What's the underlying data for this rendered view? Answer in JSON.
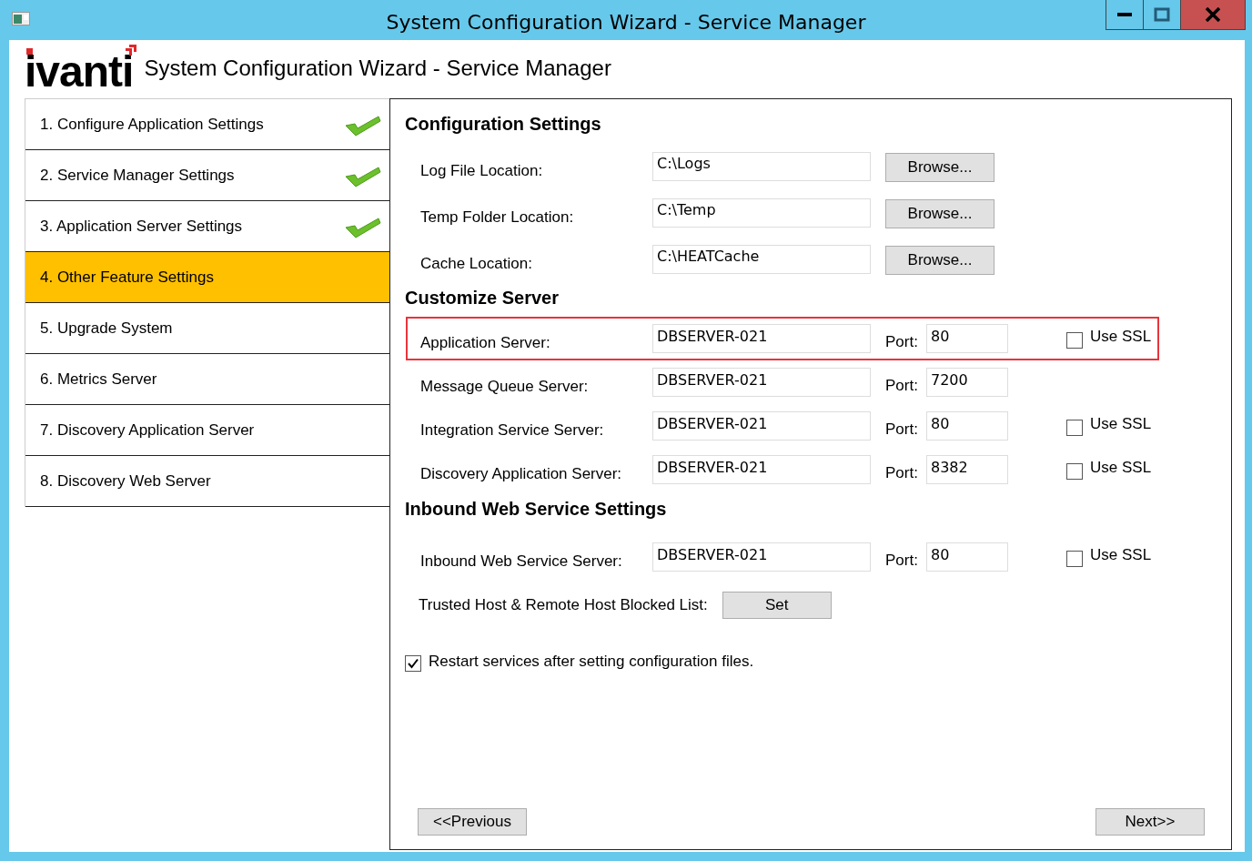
{
  "window": {
    "title": "System Configuration Wizard - Service Manager"
  },
  "header": {
    "logo": "ivanti",
    "title": "System Configuration Wizard - Service Manager"
  },
  "steps": [
    {
      "label": "1. Configure Application Settings",
      "completed": true,
      "selected": false
    },
    {
      "label": "2. Service Manager Settings",
      "completed": true,
      "selected": false
    },
    {
      "label": "3. Application Server Settings",
      "completed": true,
      "selected": false
    },
    {
      "label": "4. Other Feature Settings",
      "completed": false,
      "selected": true
    },
    {
      "label": "5. Upgrade System",
      "completed": false,
      "selected": false
    },
    {
      "label": "6. Metrics Server",
      "completed": false,
      "selected": false
    },
    {
      "label": "7. Discovery Application Server",
      "completed": false,
      "selected": false
    },
    {
      "label": "8. Discovery Web Server",
      "completed": false,
      "selected": false
    }
  ],
  "configuration": {
    "heading": "Configuration Settings",
    "rows": [
      {
        "label": "Log File Location:",
        "value": "C:\\Logs",
        "button": "Browse..."
      },
      {
        "label": "Temp Folder Location:",
        "value": "C:\\Temp",
        "button": "Browse..."
      },
      {
        "label": "Cache Location:",
        "value": "C:\\HEATCache",
        "button": "Browse..."
      }
    ]
  },
  "customize": {
    "heading": "Customize Server",
    "rows": [
      {
        "label": "Application Server:",
        "value": "DBSERVER-021",
        "port_label": "Port:",
        "port": "80",
        "ssl": {
          "label": "Use SSL",
          "checked": false
        },
        "highlighted": true
      },
      {
        "label": "Message Queue Server:",
        "value": "DBSERVER-021",
        "port_label": "Port:",
        "port": "7200",
        "highlighted": false
      },
      {
        "label": "Integration Service Server:",
        "value": "DBSERVER-021",
        "port_label": "Port:",
        "port": "80",
        "ssl": {
          "label": "Use SSL",
          "checked": false
        },
        "highlighted": false
      },
      {
        "label": "Discovery Application Server:",
        "value": "DBSERVER-021",
        "port_label": "Port:",
        "port": "8382",
        "ssl": {
          "label": "Use SSL",
          "checked": false
        },
        "highlighted": false
      }
    ]
  },
  "inbound": {
    "heading": "Inbound Web Service Settings",
    "rows": [
      {
        "label": "Inbound Web Service Server:",
        "value": "DBSERVER-021",
        "port_label": "Port:",
        "port": "80",
        "ssl": {
          "label": "Use SSL",
          "checked": false
        },
        "highlighted": false
      }
    ],
    "trusted": {
      "label": "Trusted Host & Remote Host Blocked List:",
      "button": "Set"
    }
  },
  "restart": {
    "label": "Restart services after setting configuration files.",
    "checked": true
  },
  "navigation": {
    "previous": "<<Previous",
    "next": "Next>>"
  }
}
